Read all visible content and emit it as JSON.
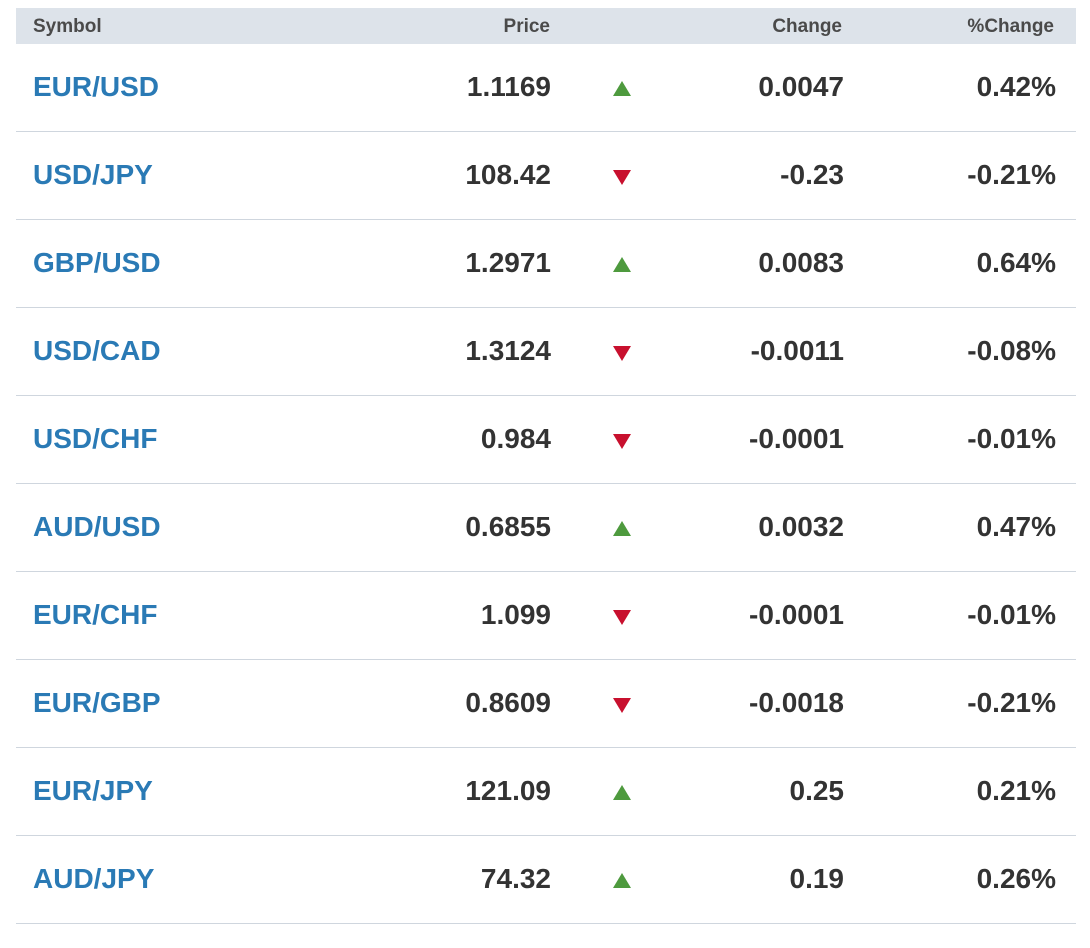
{
  "header": {
    "symbol": "Symbol",
    "price": "Price",
    "change": "Change",
    "pct_change": "%Change"
  },
  "colors": {
    "up": "#4e9a3e",
    "down": "#c8102e",
    "symbol_link": "#2a7ab5",
    "header_bg": "#dde3ea"
  },
  "rows": [
    {
      "symbol": "EUR/USD",
      "price": "1.1169",
      "direction": "up",
      "change": "0.0047",
      "pct_change": "0.42%"
    },
    {
      "symbol": "USD/JPY",
      "price": "108.42",
      "direction": "down",
      "change": "-0.23",
      "pct_change": "-0.21%"
    },
    {
      "symbol": "GBP/USD",
      "price": "1.2971",
      "direction": "up",
      "change": "0.0083",
      "pct_change": "0.64%"
    },
    {
      "symbol": "USD/CAD",
      "price": "1.3124",
      "direction": "down",
      "change": "-0.0011",
      "pct_change": "-0.08%"
    },
    {
      "symbol": "USD/CHF",
      "price": "0.984",
      "direction": "down",
      "change": "-0.0001",
      "pct_change": "-0.01%"
    },
    {
      "symbol": "AUD/USD",
      "price": "0.6855",
      "direction": "up",
      "change": "0.0032",
      "pct_change": "0.47%"
    },
    {
      "symbol": "EUR/CHF",
      "price": "1.099",
      "direction": "down",
      "change": "-0.0001",
      "pct_change": "-0.01%"
    },
    {
      "symbol": "EUR/GBP",
      "price": "0.8609",
      "direction": "down",
      "change": "-0.0018",
      "pct_change": "-0.21%"
    },
    {
      "symbol": "EUR/JPY",
      "price": "121.09",
      "direction": "up",
      "change": "0.25",
      "pct_change": "0.21%"
    },
    {
      "symbol": "AUD/JPY",
      "price": "74.32",
      "direction": "up",
      "change": "0.19",
      "pct_change": "0.26%"
    }
  ]
}
